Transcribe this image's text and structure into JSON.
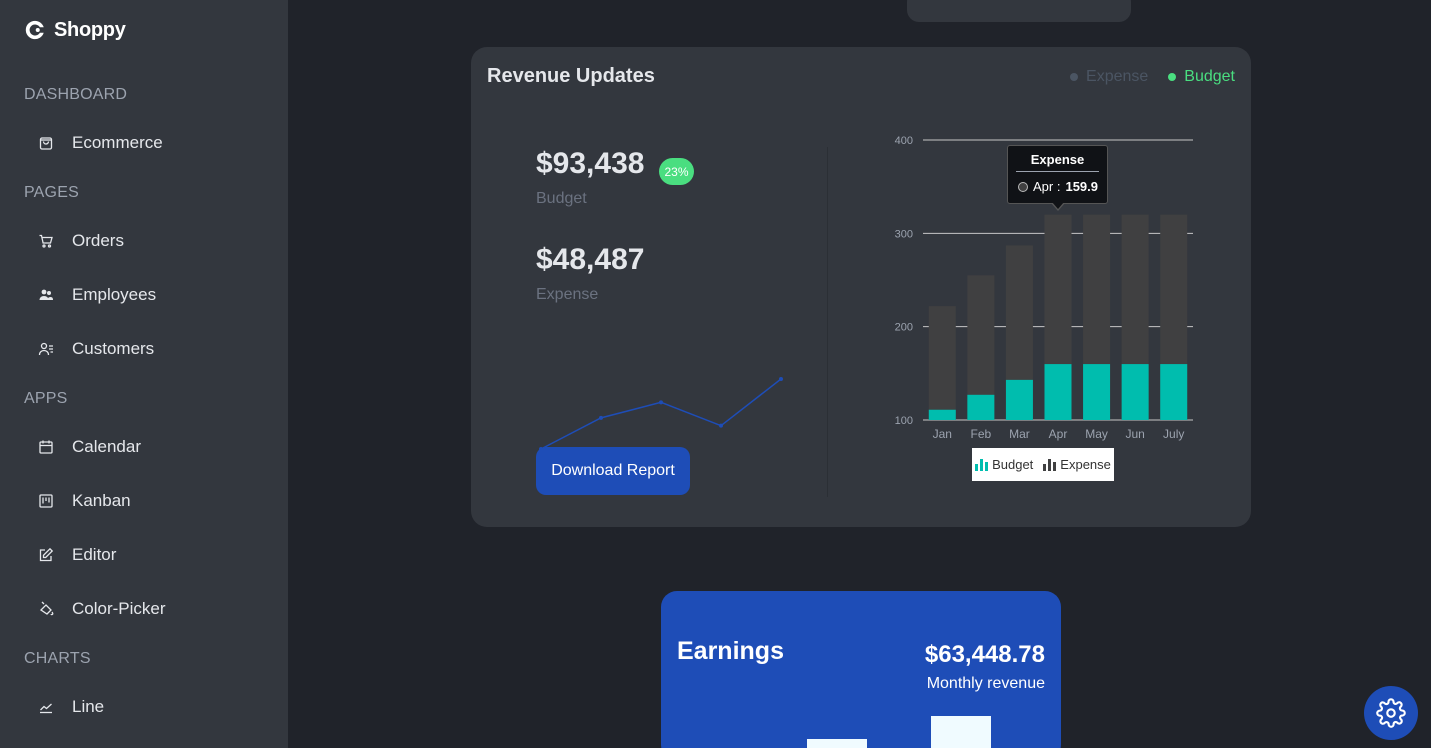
{
  "app": {
    "name": "Shoppy",
    "logo_icon": "shoppy-logo-icon"
  },
  "sidebar": {
    "sections": [
      {
        "title": "DASHBOARD",
        "items": [
          {
            "label": "Ecommerce",
            "icon": "shopping-bag-icon"
          }
        ]
      },
      {
        "title": "PAGES",
        "items": [
          {
            "label": "Orders",
            "icon": "cart-icon"
          },
          {
            "label": "Employees",
            "icon": "employees-icon"
          },
          {
            "label": "Customers",
            "icon": "customers-icon"
          }
        ]
      },
      {
        "title": "APPS",
        "items": [
          {
            "label": "Calendar",
            "icon": "calendar-icon"
          },
          {
            "label": "Kanban",
            "icon": "kanban-icon"
          },
          {
            "label": "Editor",
            "icon": "edit-icon"
          },
          {
            "label": "Color-Picker",
            "icon": "color-picker-icon"
          }
        ]
      },
      {
        "title": "CHARTS",
        "items": [
          {
            "label": "Line",
            "icon": "line-chart-icon"
          }
        ]
      }
    ]
  },
  "revenue": {
    "title": "Revenue Updates",
    "legend": {
      "expense": "Expense",
      "budget": "Budget"
    },
    "budget_value": "$93,438",
    "budget_label": "Budget",
    "badge": "23%",
    "expense_value": "$48,487",
    "expense_label": "Expense",
    "download_label": "Download Report"
  },
  "colors": {
    "accent": "#1e4db7",
    "budget_bar": "#00bdae",
    "expense_bar": "#404041",
    "badge_green": "#4ade80",
    "sidebar_bg": "#33373e",
    "page_bg": "#20232a"
  },
  "sparkline": {
    "values": [
      1,
      5,
      7,
      4,
      10
    ]
  },
  "chart_data": {
    "type": "bar",
    "categories": [
      "Jan",
      "Feb",
      "Mar",
      "Apr",
      "May",
      "Jun",
      "July"
    ],
    "series": [
      {
        "name": "Budget",
        "values": [
          111,
          127,
          143,
          159.9,
          159.9,
          159.9,
          159.9
        ]
      },
      {
        "name": "Expense",
        "values": [
          222,
          255,
          287,
          320,
          320,
          320,
          320
        ]
      }
    ],
    "yticks": [
      100,
      200,
      300,
      400
    ],
    "ylim": [
      100,
      400
    ],
    "grid": true,
    "legend": "bottom-center",
    "legend_labels": [
      "Budget",
      "Expense"
    ],
    "tooltip": {
      "series": "Expense",
      "category": "Apr",
      "value": "159.9",
      "label": "Apr :"
    }
  },
  "earnings": {
    "title": "Earnings",
    "value": "$63,448.78",
    "subtitle": "Monthly revenue"
  },
  "settings": {
    "icon": "gear-icon"
  }
}
